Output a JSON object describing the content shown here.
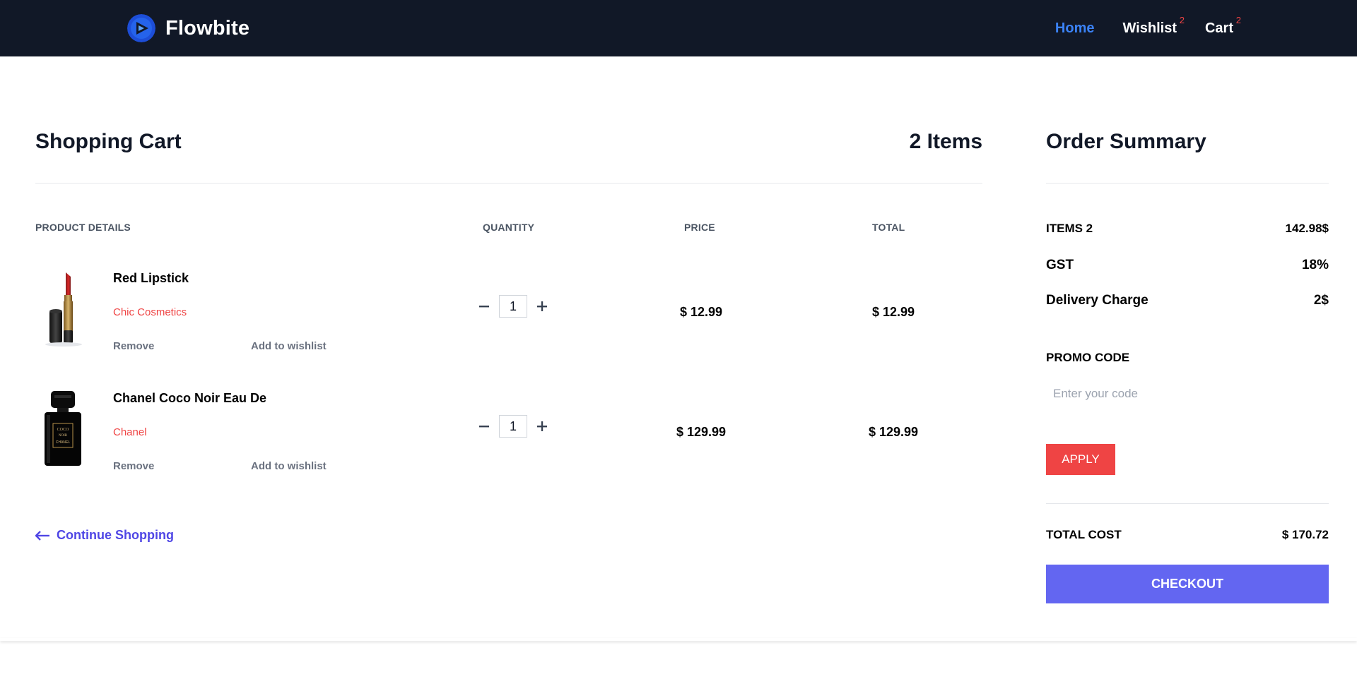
{
  "nav": {
    "brand": "Flowbite",
    "links": [
      {
        "label": "Home",
        "badge": ""
      },
      {
        "label": "Wishlist",
        "badge": "2"
      },
      {
        "label": "Cart",
        "badge": "2"
      }
    ]
  },
  "cart": {
    "title": "Shopping Cart",
    "count": "2 Items",
    "columns": {
      "product": "PRODUCT DETAILS",
      "quantity": "QUANTITY",
      "price": "PRICE",
      "total": "TOTAL"
    },
    "items": [
      {
        "name": "Red Lipstick",
        "brand": "Chic Cosmetics",
        "quantity": "1",
        "price": "$ 12.99",
        "total": "$ 12.99",
        "remove": "Remove",
        "wishlist": "Add to wishlist",
        "image": "lipstick-image"
      },
      {
        "name": "Chanel Coco Noir Eau De",
        "brand": "Chanel",
        "quantity": "1",
        "price": "$ 129.99",
        "total": "$ 129.99",
        "remove": "Remove",
        "wishlist": "Add to wishlist",
        "image": "perfume-bottle-image",
        "bottle_label": [
          "COCO",
          "NOIR",
          "CHANEL"
        ]
      }
    ],
    "continue": "Continue Shopping"
  },
  "summary": {
    "title": "Order Summary",
    "items_label": "ITEMS 2",
    "items_value": "142.98$",
    "gst_label": "GST",
    "gst_value": "18%",
    "delivery_label": "Delivery Charge",
    "delivery_value": "2$",
    "promo_label": "PROMO CODE",
    "promo_placeholder": "Enter your code",
    "apply": "APPLY",
    "total_label": "TOTAL COST",
    "total_value": "$ 170.72",
    "checkout": "CHECKOUT"
  },
  "colors": {
    "navbar": "#111827",
    "active_link": "#3b82f6",
    "badge": "#ef4444",
    "brand_text": "#ef4444",
    "link": "#4f46e5",
    "apply": "#ef4444",
    "checkout": "#6366f1"
  }
}
